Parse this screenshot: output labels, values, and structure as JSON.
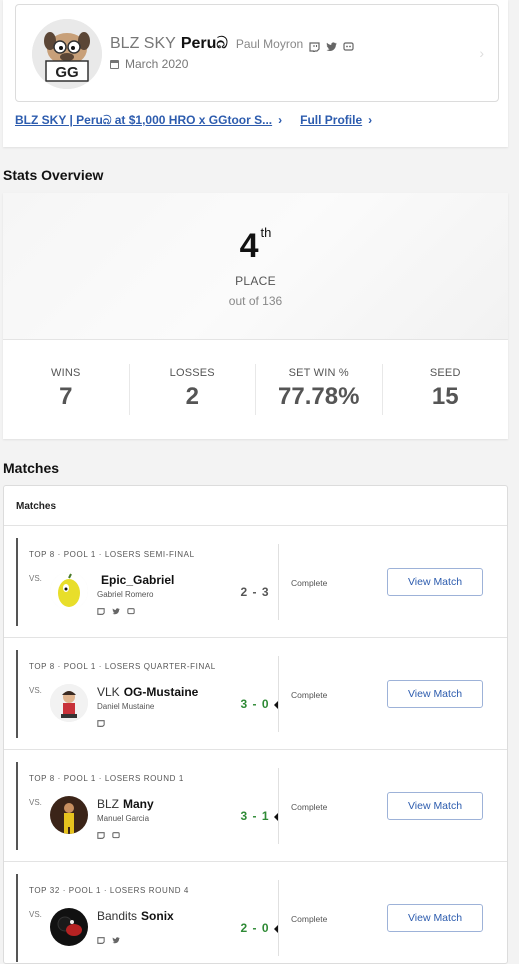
{
  "profile": {
    "prefix": "BLZ SKY",
    "tag": "Peruබ",
    "real_name": "Paul Moyron",
    "joined": "March 2020",
    "avatar_text": "GG",
    "social_icons": [
      "twitch-icon",
      "twitter-icon",
      "discord-icon"
    ]
  },
  "links": {
    "event_link": "BLZ SKY | Peruබ at $1,000 HRO x GGtoor S...",
    "full_profile": "Full Profile"
  },
  "stats_title": "Stats Overview",
  "placement": {
    "number": "4",
    "suffix": "th",
    "label": "PLACE",
    "out_of": "out of 136"
  },
  "stats": [
    {
      "label": "WINS",
      "value": "7"
    },
    {
      "label": "LOSSES",
      "value": "2"
    },
    {
      "label": "SET WIN %",
      "value": "77.78%"
    },
    {
      "label": "SEED",
      "value": "15"
    }
  ],
  "matches_title": "Matches",
  "matches_card_title": "Matches",
  "vs_label": "VS.",
  "view_button_label": "View Match",
  "matches": [
    {
      "round": "TOP 8 · POOL 1 · LOSERS SEMI-FINAL",
      "prefix": "",
      "tag": "Epic_Gabriel",
      "real_name": "Gabriel Romero",
      "score": "2 - 3",
      "result": "loss",
      "status": "Complete",
      "social_count": 3
    },
    {
      "round": "TOP 8 · POOL 1 · LOSERS QUARTER-FINAL",
      "prefix": "VLK",
      "tag": "OG-Mustaine",
      "real_name": "Daniel Mustaine",
      "score": "3 - 0",
      "result": "win",
      "status": "Complete",
      "social_count": 1
    },
    {
      "round": "TOP 8 · POOL 1 · LOSERS ROUND 1",
      "prefix": "BLZ",
      "tag": "Many",
      "real_name": "Manuel Garcia",
      "score": "3 - 1",
      "result": "win",
      "status": "Complete",
      "social_count": 2
    },
    {
      "round": "TOP 32 · POOL 1 · LOSERS ROUND 4",
      "prefix": "Bandits",
      "tag": "Sonix",
      "real_name": "",
      "score": "2 - 0",
      "result": "win",
      "status": "Complete",
      "social_count": 2
    }
  ],
  "colors": {
    "link": "#2d5cae",
    "win": "#2e8a35",
    "loss": "#555555"
  }
}
